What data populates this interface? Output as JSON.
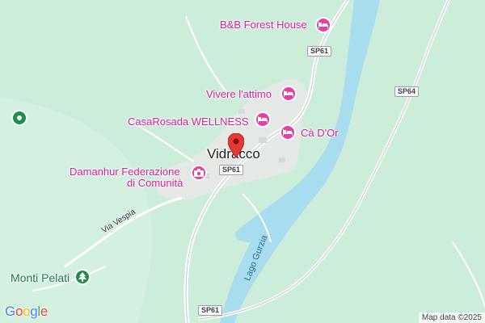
{
  "map": {
    "town": "Vidracco",
    "pois": [
      {
        "id": "bb-forest-house",
        "label": "B&B Forest House",
        "icon": "hotel-bed-icon"
      },
      {
        "id": "vivere-lattimo",
        "label": "Vivere l'attimo",
        "icon": "hotel-bed-icon"
      },
      {
        "id": "casarosada",
        "label": "CasaRosada WELLNESS",
        "icon": "hotel-bed-icon"
      },
      {
        "id": "ca-dor",
        "label": "Cà D'Or",
        "icon": "hotel-bed-icon"
      },
      {
        "id": "damanhur",
        "label_line1": "Damanhur Federazione",
        "label_line2": "di Comunità",
        "icon": "camera-icon"
      }
    ],
    "roads": {
      "sp61_a": "SP61",
      "sp61_b": "SP61",
      "sp61_c": "SP61",
      "sp64": "SP64",
      "via_vespia": "Via Vespia"
    },
    "water": {
      "lake": "Lago Gurzia"
    },
    "parks": {
      "monti_pelati": "Monti Pelati"
    },
    "logo_letters": [
      "G",
      "o",
      "o",
      "g",
      "l",
      "e"
    ],
    "attribution": "Map data ©2025",
    "colors": {
      "land": "#cfeedd",
      "water": "#a8dcef",
      "poi": "#d6209a",
      "pin": "#e53935",
      "park": "#1e7a43"
    }
  }
}
